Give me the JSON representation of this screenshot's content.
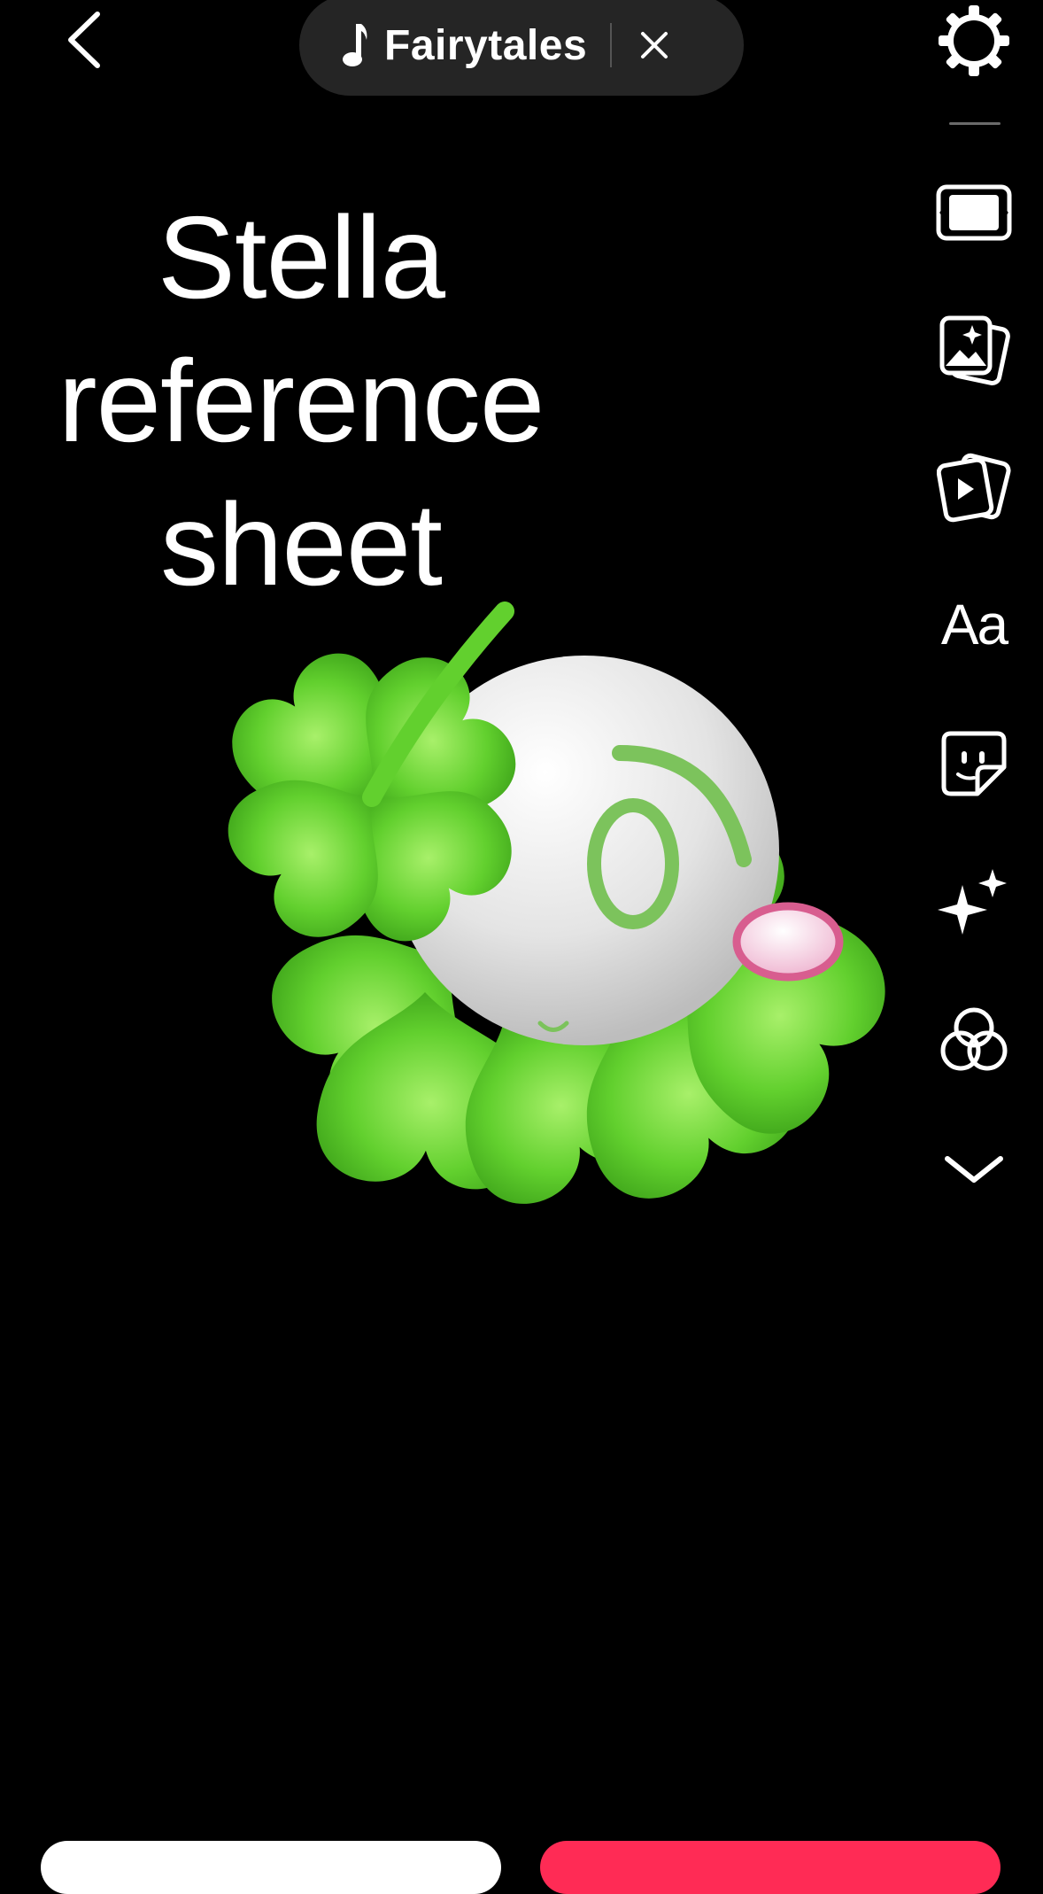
{
  "top_bar": {
    "music_title": "Fairytales",
    "back_icon": "chevron-left-icon",
    "settings_icon": "gear-icon",
    "close_icon": "close-icon",
    "note_icon": "music-note-icon"
  },
  "right_toolbar": {
    "items": [
      {
        "name": "aspect-ratio-icon"
      },
      {
        "name": "photo-sticker-icon"
      },
      {
        "name": "video-sticker-icon"
      },
      {
        "name": "text-tool",
        "label": "Aa"
      },
      {
        "name": "sticker-icon"
      },
      {
        "name": "effects-sparkle-icon"
      },
      {
        "name": "filters-icon"
      },
      {
        "name": "chevron-down-icon"
      }
    ]
  },
  "canvas": {
    "headline_lines": [
      "Stella",
      "reference",
      "sheet"
    ],
    "character": "clover-character"
  },
  "colors": {
    "background": "#000000",
    "pill": "#252525",
    "leaf_green": "#6fd83a",
    "accent_pink": "#ff2b55",
    "eye_green": "#7cc35c",
    "cheek_pink": "#f6cde0"
  }
}
